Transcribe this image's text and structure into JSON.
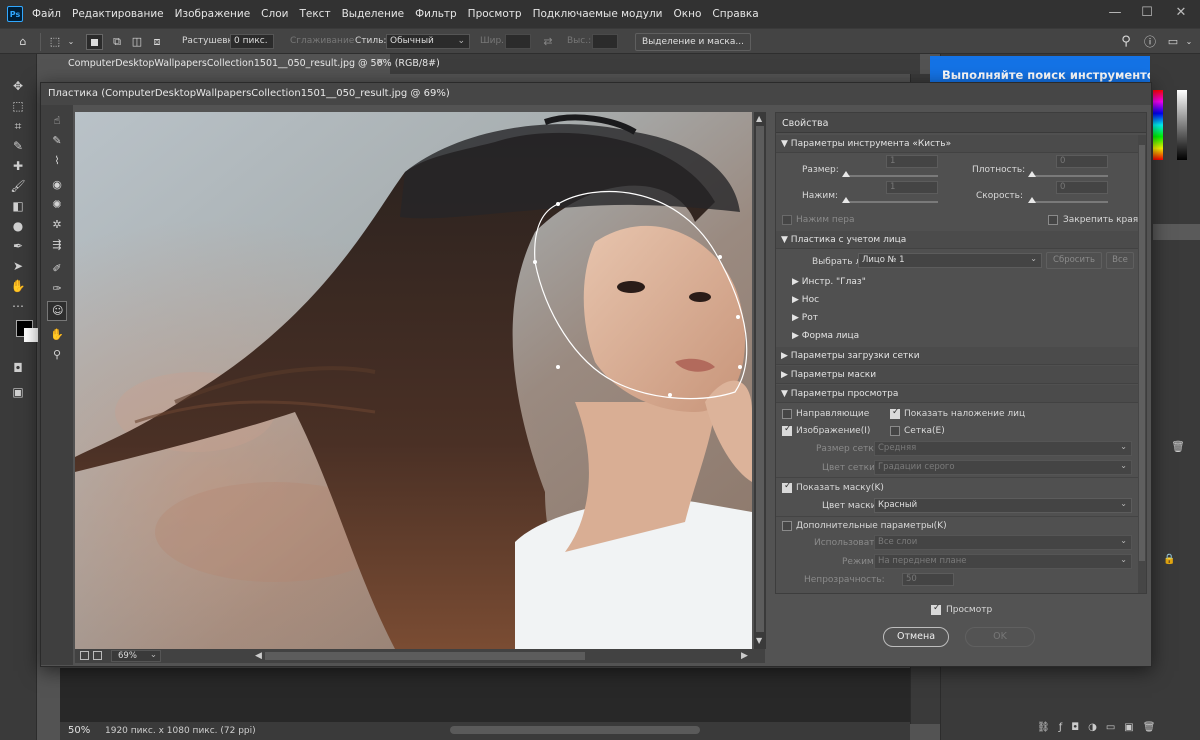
{
  "app": {
    "logo": "Ps",
    "menu": [
      "Файл",
      "Редактирование",
      "Изображение",
      "Слои",
      "Текст",
      "Выделение",
      "Фильтр",
      "Просмотр",
      "Подключаемые модули",
      "Окно",
      "Справка"
    ]
  },
  "options_bar": {
    "feather_label": "Растушевка:",
    "feather_value": "0 пикс.",
    "antialias_label": "Сглаживание",
    "style_label": "Стиль:",
    "style_value": "Обычный",
    "width_label": "Шир.:",
    "height_label": "Выс.:",
    "select_mask_button": "Выделение и маска..."
  },
  "document": {
    "tab_title": "ComputerDesktopWallpapersCollection1501__050_result.jpg @ 50% (RGB/8#)",
    "zoom": "50%",
    "doc_info": "1920 пикс. x 1080 пикс. (72 ppi)"
  },
  "tooltip": {
    "text": "Выполняйте поиск инструментов,"
  },
  "dialog": {
    "title": "Пластика (ComputerDesktopWallpapersCollection1501__050_result.jpg @ 69%)",
    "zoom_value": "69%",
    "properties_title": "Свойства",
    "brush_section": {
      "title": "Параметры инструмента «Кисть»",
      "size_label": "Размер:",
      "size_value": "1",
      "density_label": "Плотность:",
      "density_value": "0",
      "pressure_label": "Нажим:",
      "pressure_value": "1",
      "rate_label": "Скорость:",
      "rate_value": "0",
      "stylus_label": "Нажим пера",
      "pin_edges_label": "Закрепить края"
    },
    "face_section": {
      "title": "Пластика с учетом лица",
      "select_face_label": "Выбрать лицо:",
      "select_face_value": "Лицо № 1",
      "reset_button": "Сбросить",
      "all_button": "Все",
      "subsections": [
        "Инстр. \"Глаз\"",
        "Нос",
        "Рот",
        "Форма лица"
      ]
    },
    "load_mesh_title": "Параметры загрузки сетки",
    "mask_title": "Параметры маски",
    "view_section": {
      "title": "Параметры просмотра",
      "guides_label": "Направляющие",
      "show_face_overlay_label": "Показать наложение лиц",
      "image_label": "Изображение(I)",
      "mesh_label": "Сетка(E)",
      "mesh_size_label": "Размер сетки:",
      "mesh_size_value": "Средняя",
      "mesh_color_label": "Цвет сетки:",
      "mesh_color_value": "Градации серого",
      "show_mask_label": "Показать маску(K)",
      "mask_color_label": "Цвет маски:",
      "mask_color_value": "Красный",
      "extra_label": "Дополнительные параметры(K)",
      "use_label": "Использовать:",
      "use_value": "Все слои",
      "mode_label": "Режим:",
      "mode_value": "На переднем плане",
      "opacity_label": "Непрозрачность:",
      "opacity_value": "50"
    },
    "preview_label": "Просмотр",
    "cancel_button": "Отмена",
    "ok_button": "OK"
  },
  "colors": {
    "accent": "#1473e6",
    "ui_dark": "#323232",
    "panel": "#535353"
  }
}
